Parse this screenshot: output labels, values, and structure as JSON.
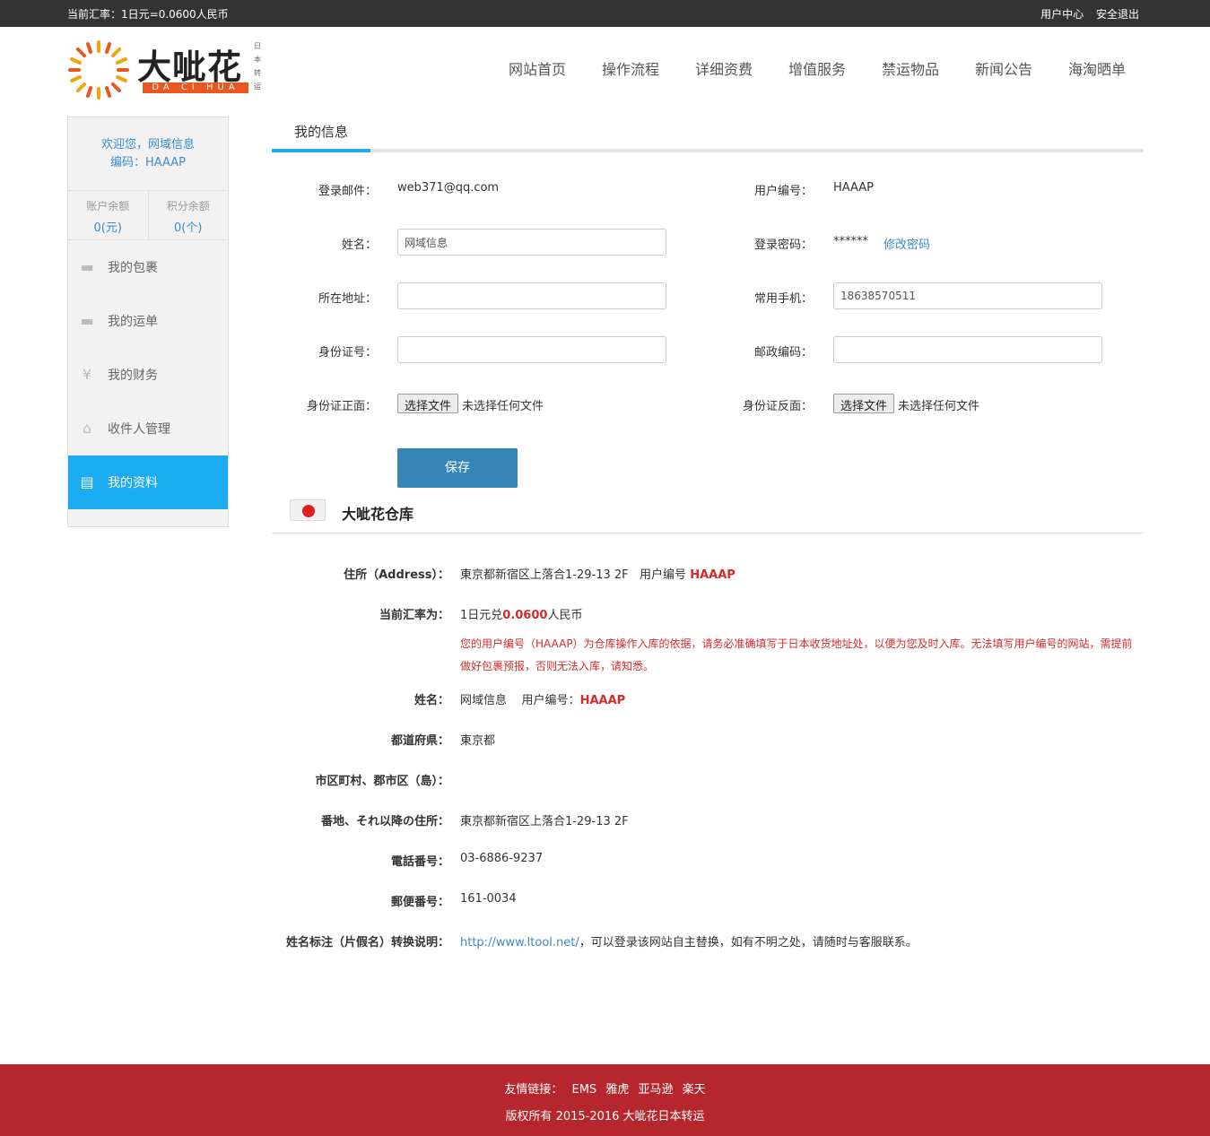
{
  "topbar": {
    "rate": "当前汇率：1日元=0.0600人民币",
    "user_center": "用户中心",
    "logout": "安全退出"
  },
  "logo": {
    "cn": "大呲花",
    "en": "DA CI HUA",
    "side": [
      "日",
      "本",
      "转",
      "运"
    ]
  },
  "nav": [
    "网站首页",
    "操作流程",
    "详细资费",
    "增值服务",
    "禁运物品",
    "新闻公告",
    "海淘晒单"
  ],
  "sidebar": {
    "welcome": "欢迎您，网域信息",
    "code": "编码：HAAAP",
    "balance_label": "账户余额",
    "balance_value": "0(元)",
    "points_label": "积分余额",
    "points_value": "0(个)",
    "items": [
      {
        "label": "我的包裹",
        "icon": "package-icon"
      },
      {
        "label": "我的运单",
        "icon": "waybill-icon"
      },
      {
        "label": "我的财务",
        "icon": "yen-icon"
      },
      {
        "label": "收件人管理",
        "icon": "home-icon"
      },
      {
        "label": "我的资料",
        "icon": "id-card-icon"
      }
    ]
  },
  "tab": "我的信息",
  "form": {
    "email_label": "登录邮件：",
    "email_value": "web371@qq.com",
    "usercode_label": "用户编号：",
    "usercode_value": "HAAAP",
    "name_label": "姓名：",
    "name_value": "网域信息",
    "password_label": "登录密码：",
    "password_value": "******",
    "change_password": "修改密码",
    "address_label": "所在地址：",
    "address_value": "",
    "phone_label": "常用手机：",
    "phone_value": "18638570511",
    "idno_label": "身份证号：",
    "idno_value": "",
    "zip_label": "邮政编码：",
    "zip_value": "",
    "idfront_label": "身份证正面：",
    "idback_label": "身份证反面：",
    "file_button": "选择文件",
    "file_none": "未选择任何文件",
    "save": "保存"
  },
  "warehouse": {
    "title": "大呲花仓库",
    "address_label": "住所（Address）：",
    "address_value": "東京都新宿区上落合1-29-13 2F",
    "address_code_prefix": "用户编号",
    "address_code": "HAAAP",
    "rate_label": "当前汇率为：",
    "rate_prefix": "1日元兑",
    "rate_value": "0.0600",
    "rate_suffix": "人民币",
    "notice": "您的用户编号（HAAAP）为仓库操作入库的依据，请务必准确填写于日本收货地址处，以便为您及时入库。无法填写用户编号的网站，需提前做好包裹预报，否则无法入库，请知悉。",
    "name_label": "姓名：",
    "name_value": "网域信息",
    "name_code_prefix": "用户编号：",
    "name_code": "HAAAP",
    "pref_label": "都道府県：",
    "pref_value": "東京都",
    "city_label": "市区町村、郡市区（島）：",
    "city_value": "",
    "street_label": "番地、それ以降の住所：",
    "street_value": "東京都新宿区上落合1-29-13 2F",
    "tel_label": "電話番号：",
    "tel_value": "03-6886-9237",
    "postal_label": "郵便番号：",
    "postal_value": "161-0034",
    "kana_label": "姓名标注（片假名）转换说明：",
    "kana_link": "http://www.ltool.net/",
    "kana_text": "，可以登录该网站自主替换，如有不明之处，请随时与客服联系。"
  },
  "footer": {
    "links_label": "友情链接：",
    "links": [
      "EMS",
      "雅虎",
      "亚马逊",
      "楽天"
    ],
    "copyright": "版权所有 2015-2016 大呲花日本转运"
  },
  "colors": {
    "accent": "#1aabf0",
    "save": "#3585b7",
    "footer": "#b5272d",
    "red": "#d42a2a",
    "link": "#3a8bc9"
  }
}
